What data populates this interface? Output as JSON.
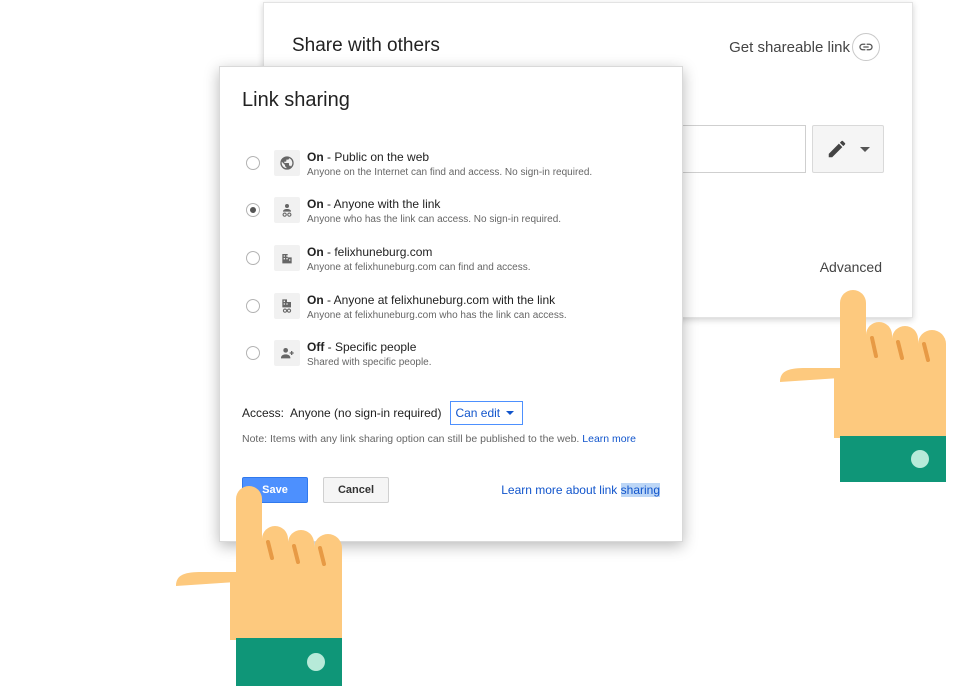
{
  "background_card": {
    "title": "Share with others",
    "shareable_link_label": "Get shareable link",
    "advanced_label": "Advanced"
  },
  "dialog": {
    "title": "Link sharing",
    "options": [
      {
        "state": "On",
        "rest": " - Public on the web",
        "description": "Anyone on the Internet can find and access. No sign-in required.",
        "icon": "globe-icon",
        "selected": false
      },
      {
        "state": "On",
        "rest": " - Anyone with the link",
        "description": "Anyone who has the link can access. No sign-in required.",
        "icon": "person-link-icon",
        "selected": true
      },
      {
        "state": "On",
        "rest": " - felixhuneburg.com",
        "description": "Anyone at felixhuneburg.com can find and access.",
        "icon": "building-icon",
        "selected": false
      },
      {
        "state": "On",
        "rest": " - Anyone at felixhuneburg.com with the link",
        "description": "Anyone at felixhuneburg.com who has the link can access.",
        "icon": "building-link-icon",
        "selected": false
      },
      {
        "state": "Off",
        "rest": " - Specific people",
        "description": "Shared with specific people.",
        "icon": "person-add-icon",
        "selected": false
      }
    ],
    "access": {
      "label": "Access:",
      "value": "Anyone (no sign-in required)",
      "permission": "Can edit"
    },
    "note": {
      "text": "Note: Items with any link sharing option can still be published to the web.",
      "link": "Learn more"
    },
    "buttons": {
      "save": "Save",
      "cancel": "Cancel"
    },
    "learn_more": {
      "prefix": "Learn more about link ",
      "highlighted": "sharing"
    }
  },
  "colors": {
    "primary_blue": "#4d90fe",
    "link_blue": "#1155cc",
    "hand_skin": "#fdc97e",
    "cuff_green": "#0f9678",
    "cuff_button": "#b7ead9"
  }
}
